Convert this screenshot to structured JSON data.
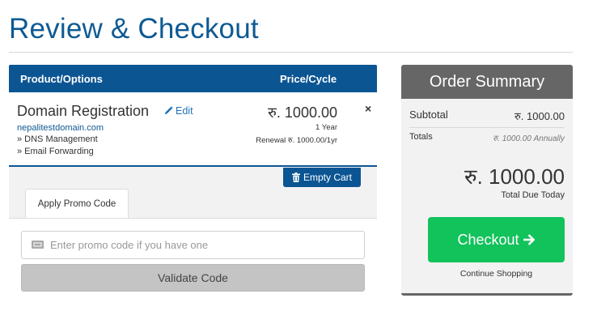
{
  "page": {
    "title": "Review & Checkout"
  },
  "cart": {
    "headers": {
      "product": "Product/Options",
      "price": "Price/Cycle"
    },
    "item": {
      "name": "Domain Registration",
      "edit_label": "Edit",
      "domain": "nepalitestdomain.com",
      "addons": [
        "» DNS Management",
        "» Email Forwarding"
      ],
      "price": "रु. 1000.00",
      "cycle": "1 Year",
      "renewal": "Renewal रु. 1000.00/1yr",
      "remove_symbol": "×"
    },
    "empty_cart_label": "Empty Cart"
  },
  "promo": {
    "tab_label": "Apply Promo Code",
    "placeholder": "Enter promo code if you have one",
    "validate_label": "Validate Code"
  },
  "summary": {
    "title": "Order Summary",
    "subtotal_label": "Subtotal",
    "subtotal_value": "रु. 1000.00",
    "totals_label": "Totals",
    "totals_value": "रु. 1000.00 Annually",
    "due_amount": "रु. 1000.00",
    "due_label": "Total Due Today",
    "checkout_label": "Checkout",
    "continue_label": "Continue Shopping"
  },
  "colors": {
    "brand_blue": "#0b5593",
    "title_blue": "#0e5a93",
    "checkout_green": "#12c25b",
    "summary_header": "#666666"
  },
  "icons": {
    "edit": "pencil-icon",
    "remove": "close-icon",
    "empty_cart": "trash-icon",
    "promo": "ticket-icon",
    "checkout": "arrow-right-icon"
  }
}
